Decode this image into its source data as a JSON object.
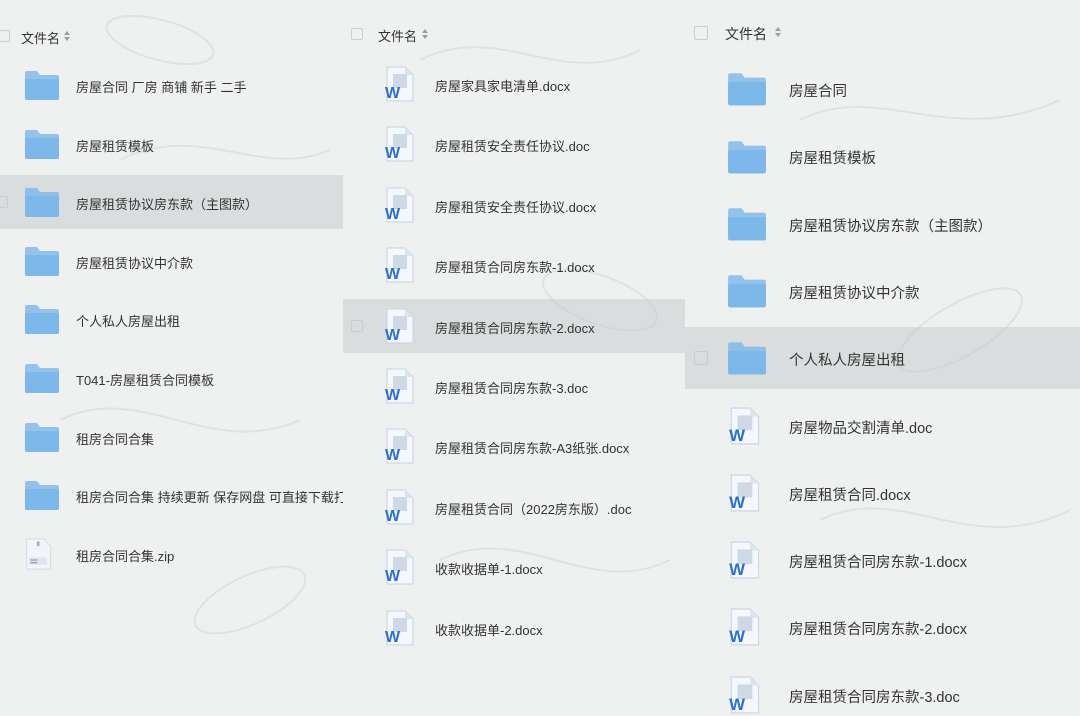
{
  "panels": [
    {
      "header_label": "文件名",
      "rows": [
        {
          "name": "房屋合同  厂房 商铺  新手 二手",
          "icon": "folder-icon"
        },
        {
          "name": "房屋租赁模板",
          "icon": "folder-icon"
        },
        {
          "name": "房屋租赁协议房东款（主图款）",
          "icon": "folder-icon",
          "selected": true
        },
        {
          "name": "房屋租赁协议中介款",
          "icon": "folder-icon"
        },
        {
          "name": "个人私人房屋出租",
          "icon": "folder-icon"
        },
        {
          "name": "T041-房屋租赁合同模板",
          "icon": "folder-icon"
        },
        {
          "name": "租房合同合集",
          "icon": "folder-icon"
        },
        {
          "name": "租房合同合集  持续更新 保存网盘  可直接下载打印",
          "icon": "folder-icon"
        },
        {
          "name": "租房合同合集.zip",
          "icon": "zip-file-icon"
        }
      ]
    },
    {
      "header_label": "文件名",
      "rows": [
        {
          "name": "房屋家具家电清单.docx",
          "icon": "word-doc-icon"
        },
        {
          "name": "房屋租赁安全责任协议.doc",
          "icon": "word-doc-icon"
        },
        {
          "name": "房屋租赁安全责任协议.docx",
          "icon": "word-doc-icon"
        },
        {
          "name": "房屋租赁合同房东款-1.docx",
          "icon": "word-doc-icon"
        },
        {
          "name": "房屋租赁合同房东款-2.docx",
          "icon": "word-doc-icon",
          "selected": true
        },
        {
          "name": "房屋租赁合同房东款-3.doc",
          "icon": "word-doc-icon"
        },
        {
          "name": "房屋租赁合同房东款-A3纸张.docx",
          "icon": "word-doc-icon"
        },
        {
          "name": "房屋租赁合同（2022房东版）.doc",
          "icon": "word-doc-icon"
        },
        {
          "name": "收款收据单-1.docx",
          "icon": "word-doc-icon"
        },
        {
          "name": "收款收据单-2.docx",
          "icon": "word-doc-icon"
        }
      ]
    },
    {
      "header_label": "文件名",
      "rows": [
        {
          "name": "房屋合同",
          "icon": "folder-icon"
        },
        {
          "name": "房屋租赁模板",
          "icon": "folder-icon"
        },
        {
          "name": "房屋租赁协议房东款（主图款）",
          "icon": "folder-icon"
        },
        {
          "name": "房屋租赁协议中介款",
          "icon": "folder-icon"
        },
        {
          "name": "个人私人房屋出租",
          "icon": "folder-icon",
          "selected": true
        },
        {
          "name": "房屋物品交割清单.doc",
          "icon": "word-doc-icon"
        },
        {
          "name": "房屋租赁合同.docx",
          "icon": "word-doc-icon"
        },
        {
          "name": "房屋租赁合同房东款-1.docx",
          "icon": "word-doc-icon"
        },
        {
          "name": "房屋租赁合同房东款-2.docx",
          "icon": "word-doc-icon"
        },
        {
          "name": "房屋租赁合同房东款-3.doc",
          "icon": "word-doc-icon"
        }
      ]
    }
  ],
  "colors": {
    "background": "#eef1ef",
    "folder": "#7cb8ea",
    "word_blue": "#2a6fd6",
    "selected_row": "#d3d6d9"
  }
}
